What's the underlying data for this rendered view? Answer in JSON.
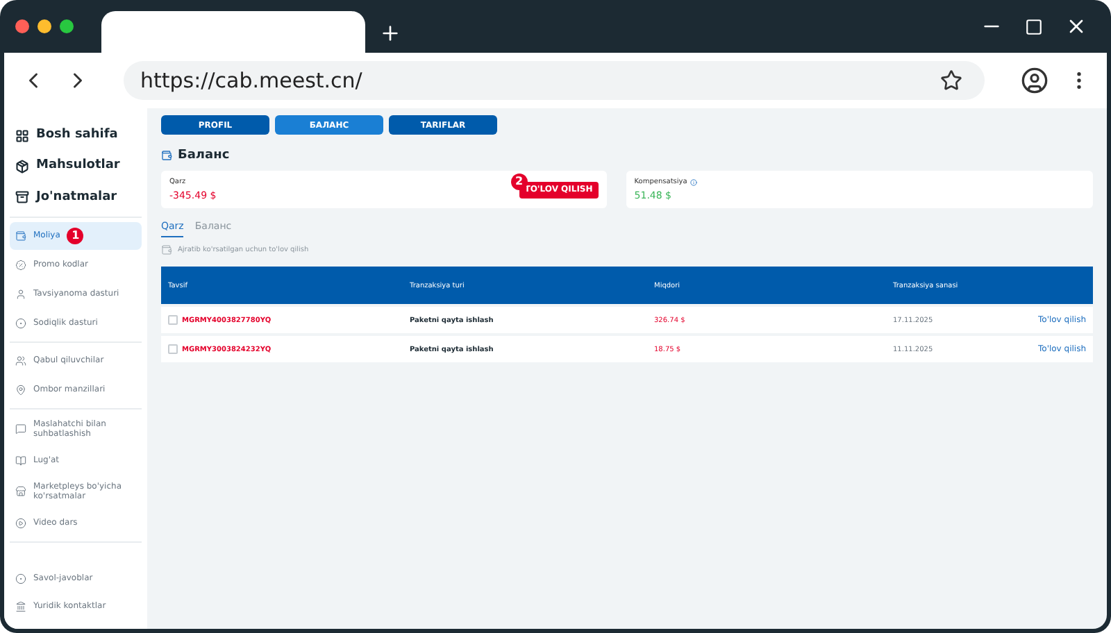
{
  "browser": {
    "url": "https://cab.meest.cn/"
  },
  "sidebar": {
    "groups": [
      [
        {
          "label": "Bosh sahifa",
          "selected": false
        },
        {
          "label": "Mahsulotlar",
          "selected": false
        },
        {
          "label": "Jo'natmalar",
          "selected": false
        }
      ],
      [
        {
          "label": "Moliya",
          "selected": true,
          "badge": "1"
        },
        {
          "label": "Promo kodlar",
          "selected": false
        },
        {
          "label": "Tavsiyanoma dasturi",
          "selected": false
        },
        {
          "label": "Sodiqlik dasturi",
          "selected": false
        }
      ],
      [
        {
          "label": "Qabul qiluvchilar",
          "selected": false
        },
        {
          "label": "Ombor manzillari",
          "selected": false
        }
      ],
      [
        {
          "label": "Maslahatchi bilan suhbatlashish",
          "selected": false
        },
        {
          "label": "Lug'at",
          "selected": false
        },
        {
          "label": "Marketpleys bo'yicha ko'rsatmalar",
          "selected": false
        },
        {
          "label": "Video dars",
          "selected": false
        }
      ]
    ],
    "footer": [
      {
        "label": "Savol-javoblar"
      },
      {
        "label": "Yuridik kontaktlar"
      }
    ]
  },
  "top_tabs": [
    {
      "label": "PROFIL",
      "selected": false
    },
    {
      "label": "БАЛАНС",
      "selected": true
    },
    {
      "label": "TARIFLAR",
      "selected": false
    }
  ],
  "heading": "Баланс",
  "debt_card": {
    "label": "Qarz",
    "amount": "-345.49 $",
    "button": "TO'LOV QILISH",
    "badge": "2"
  },
  "comp_card": {
    "label": "Kompensatsiya",
    "amount": "51.48 $"
  },
  "sub_tabs": [
    {
      "label": "Qarz",
      "selected": true
    },
    {
      "label": "Баланс",
      "selected": false
    }
  ],
  "hint": "Ajratib ko'rsatilgan uchun to'lov qilish",
  "table": {
    "columns": [
      "Tavsif",
      "Tranzaksiya turi",
      "Miqdori",
      "Tranzaksiya sanasi"
    ],
    "rows": [
      {
        "id": "MGRMY4003827780YQ",
        "type": "Paketni qayta ishlash",
        "amount": "326.74 $",
        "date": "17.11.2025",
        "action": "To'lov qilish",
        "checked": false
      },
      {
        "id": "MGRMY3003824232YQ",
        "type": "Paketni qayta ishlash",
        "amount": "18.75 $",
        "date": "11.11.2025",
        "action": "To'lov qilish",
        "checked": false
      }
    ]
  }
}
